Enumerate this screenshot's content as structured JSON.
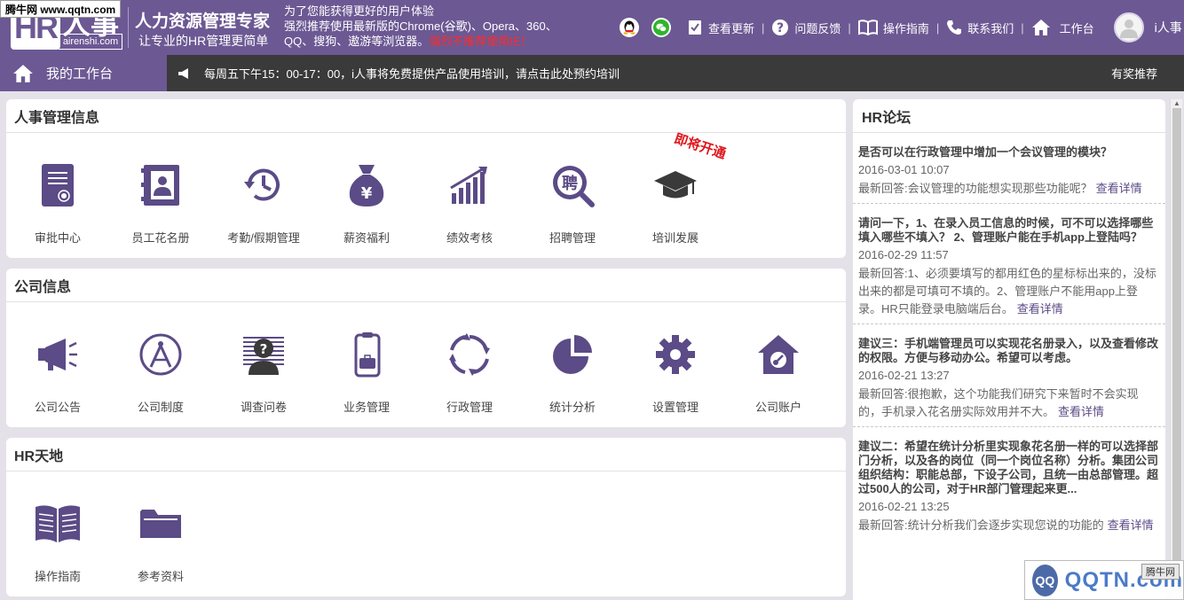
{
  "watermark_top": "腾牛网 www.qqtn.com",
  "header": {
    "logo_letters": "HR",
    "logo_char": "人事",
    "logo_domain": "airenshi.com",
    "brand_title": "人力资源管理专家",
    "brand_sub": "让专业的HR管理更简单",
    "notice_line1": "为了您能获得更好的用户体验",
    "notice_line2": "强烈推荐使用最新版的Chrome(谷歌)、Opera、360、",
    "notice_line3": "QQ、搜狗、遨游等浏览器。",
    "notice_warn": "强烈不推荐使用IE！",
    "toolbar": {
      "check_update": "查看更新",
      "feedback": "问题反馈",
      "guide": "操作指南",
      "contact": "联系我们",
      "workbench": "工作台",
      "user": "i人事"
    }
  },
  "nav": {
    "home": "我的工作台",
    "announcement": "每周五下午15：00-17：00，i人事将免费提供产品使用培训，请点击此处预约培训",
    "recommend": "有奖推荐"
  },
  "sections": {
    "hr_info": {
      "title": "人事管理信息",
      "badge": "即将开通",
      "items": [
        "审批中心",
        "员工花名册",
        "考勤/假期管理",
        "薪资福利",
        "绩效考核",
        "招聘管理",
        "培训发展"
      ]
    },
    "company": {
      "title": "公司信息",
      "items": [
        "公司公告",
        "公司制度",
        "调查问卷",
        "业务管理",
        "行政管理",
        "统计分析",
        "设置管理",
        "公司账户"
      ]
    },
    "hr_world": {
      "title": "HR天地",
      "items": [
        "操作指南",
        "参考资料"
      ]
    }
  },
  "forum": {
    "title": "HR论坛",
    "link_label": "查看详情",
    "posts": [
      {
        "title": "是否可以在行政管理中增加一个会议管理的模块？",
        "date": "2016-03-01 10:07",
        "answer": "最新回答:会议管理的功能想实现那些功能呢？"
      },
      {
        "title": "请问一下，1、在录入员工信息的时候，可不可以选择哪些填入哪些不填入？ 2、管理账户能在手机app上登陆吗？",
        "date": "2016-02-29 11:57",
        "answer": "最新回答:1、必须要填写的都用红色的星标标出来的，没标出来的都是可填可不填的。2、管理账户不能用app上登录。HR只能登录电脑端后台。"
      },
      {
        "title": "建议三：手机端管理员可以实现花名册录入，以及查看修改的权限。方便与移动办公。希望可以考虑。",
        "date": "2016-02-21 13:27",
        "answer": "最新回答:很抱歉，这个功能我们研究下来暂时不会实现的，手机录入花名册实际效用并不大。"
      },
      {
        "title": "建议二：希望在统计分析里实现象花名册一样的可以选择部门分析，以及各的岗位（同一个岗位名称）分析。集团公司组织结构：职能总部，下设子公司，且统一由总部管理。超过500人的公司，对于HR部门管理起来更...",
        "date": "2016-02-21 13:25",
        "answer": "最新回答:统计分析我们会逐步实现您说的功能的"
      }
    ]
  },
  "watermark_br": {
    "circle": "QQ",
    "text": "QQTN.com",
    "tag": "腾牛网"
  },
  "colors": {
    "brand_purple": "#6c5893",
    "icon_purple": "#5b4b86",
    "dark_bar": "#3a3a3a",
    "warn_red": "#ff2a2a",
    "badge_red": "#e0141a"
  }
}
